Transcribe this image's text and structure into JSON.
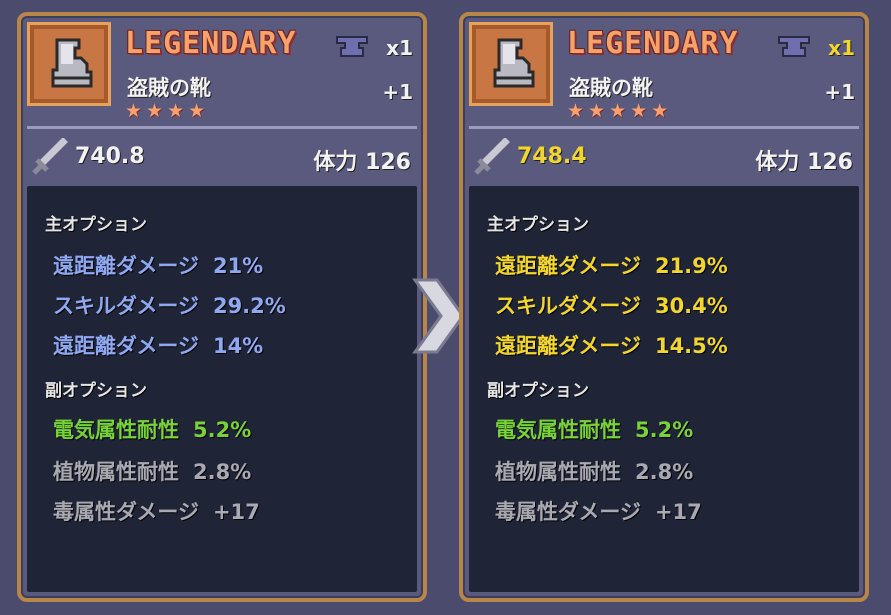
{
  "colors": {
    "main_option_before": "#8fa8f2",
    "main_option_after": "#f2d52e",
    "sub_option_highlight": "#78d23a",
    "sub_option_normal": "#a9a9b3",
    "rarity_text": "#f4a36b",
    "frame": "#b9864a"
  },
  "left": {
    "rarity": "LEGENDARY",
    "name": "盗賊の靴",
    "stars": [
      "★",
      "★",
      "★",
      "★"
    ],
    "count": "x1",
    "plus": "+1",
    "power": "740.8",
    "stamina": "体力 126",
    "main_header": "主オプション",
    "main_options": [
      {
        "label": "遠距離ダメージ",
        "value": "21%"
      },
      {
        "label": "スキルダメージ",
        "value": "29.2%"
      },
      {
        "label": "遠距離ダメージ",
        "value": "14%"
      }
    ],
    "sub_header": "副オプション",
    "sub_options": [
      {
        "label": "電気属性耐性",
        "value": "5.2%"
      },
      {
        "label": "植物属性耐性",
        "value": "2.8%"
      },
      {
        "label": "毒属性ダメージ",
        "value": "+17"
      }
    ]
  },
  "right": {
    "rarity": "LEGENDARY",
    "name": "盗賊の靴",
    "stars": [
      "★",
      "★",
      "★",
      "★",
      "★"
    ],
    "count": "x1",
    "plus": "+1",
    "power": "748.4",
    "stamina": "体力 126",
    "main_header": "主オプション",
    "main_options": [
      {
        "label": "遠距離ダメージ",
        "value": "21.9%"
      },
      {
        "label": "スキルダメージ",
        "value": "30.4%"
      },
      {
        "label": "遠距離ダメージ",
        "value": "14.5%"
      }
    ],
    "sub_header": "副オプション",
    "sub_options": [
      {
        "label": "電気属性耐性",
        "value": "5.2%"
      },
      {
        "label": "植物属性耐性",
        "value": "2.8%"
      },
      {
        "label": "毒属性ダメージ",
        "value": "+17"
      }
    ]
  }
}
